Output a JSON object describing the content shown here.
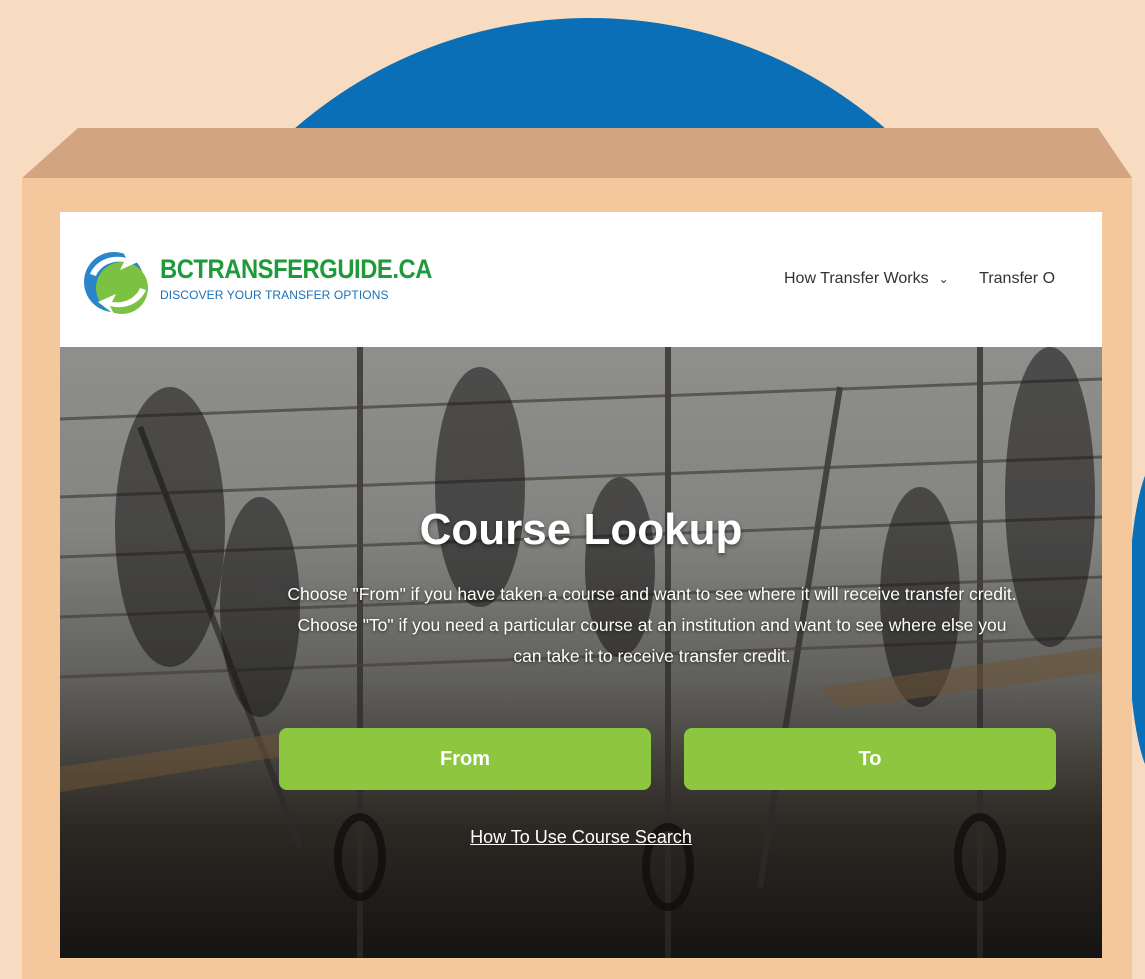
{
  "colors": {
    "accent": "#8dc63f",
    "brand_blue": "#0b6fb7",
    "box_front": "#f4c89c",
    "box_lid": "#d2a580"
  },
  "header": {
    "logo": {
      "title": "BCTRANSFERGUIDE.CA",
      "tagline": "DISCOVER YOUR TRANSFER OPTIONS",
      "icon": "bctransferguide-logo-arrows"
    },
    "nav": [
      {
        "label": "How Transfer Works",
        "icon": "chevron-down-icon"
      },
      {
        "label": "Transfer O"
      }
    ]
  },
  "hero": {
    "title": "Course Lookup",
    "description": "Choose \"From\" if you have taken a course and want to see where it will receive transfer credit. Choose \"To\" if you need a particular course at an institution and want to see where else you can take it to receive transfer credit.",
    "buttons": {
      "from": "From",
      "to": "To"
    },
    "help_link": "How To Use Course Search"
  }
}
